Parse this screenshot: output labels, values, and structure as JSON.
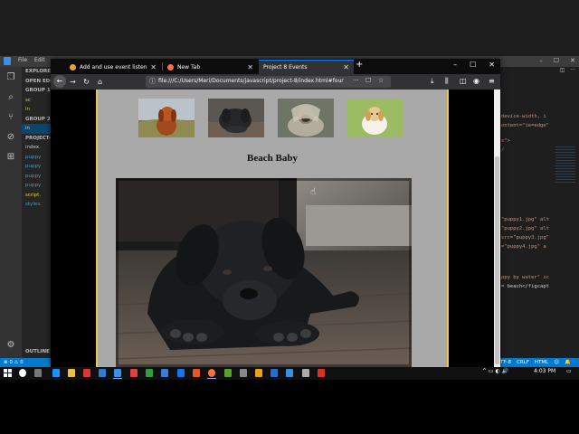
{
  "vscode": {
    "menu": [
      "File",
      "Edit"
    ],
    "explorer": {
      "title": "EXPLORER",
      "open_editors": "OPEN EDI",
      "group1": "GROUP 1",
      "group1_files": [
        "sc",
        "in"
      ],
      "group2": "GROUP 2",
      "group2_files": [
        "in"
      ],
      "project": "PROJECT-",
      "files": [
        "index.",
        "puppy",
        "puppy",
        "puppy",
        "puppy",
        "script.",
        "styles."
      ],
      "outline": "OUTLINE"
    },
    "code_lines": [
      {
        "text": "device-width, i",
        "color": "#ce9178"
      },
      {
        "text": "ontent=\"ie=edge\"",
        "color": "#ce9178"
      },
      {
        "text": "s\">",
        "color": "#ce9178"
      },
      {
        "text": "/",
        "color": "#808080"
      },
      {
        "text": "\"puppy1.jpg\" alt",
        "color": "#ce9178"
      },
      {
        "text": "\"puppy2.jpg\" alt",
        "color": "#ce9178"
      },
      {
        "text": "src=\"puppy3.jpg\"",
        "color": "#ce9178"
      },
      {
        "text": "=\"puppy4.jpg\" a",
        "color": "#ce9178"
      },
      {
        "text": "ppy by water\" ic",
        "color": "#ce9178"
      },
      {
        "text": "= beach</figcapt",
        "color": "#d4d4d4"
      }
    ],
    "status_left": "⊗ 0 ⚠ 0",
    "status_right": [
      "TF-8",
      "CRLF",
      "HTML",
      "☺",
      "🔔"
    ]
  },
  "browser": {
    "tabs": [
      {
        "title": "Add and use event listeners",
        "favicon_color": "#e8a23a",
        "active": false
      },
      {
        "title": "New Tab",
        "favicon_color": "#ff7139",
        "active": false
      },
      {
        "title": "Project 8 Events",
        "favicon_color": "",
        "active": true
      }
    ],
    "new_tab_symbol": "+",
    "window_controls": [
      "–",
      "☐",
      "✕"
    ],
    "url": "file:///C:/Users/Meri/Documents/javascript/project-8/index.html#four",
    "url_actions": [
      "···",
      "☐",
      "☆"
    ]
  },
  "page": {
    "caption": "Beach Baby",
    "thumbnails": [
      {
        "name": "puppy-thumbnail-1",
        "interactable": true
      },
      {
        "name": "puppy-thumbnail-2",
        "interactable": true
      },
      {
        "name": "puppy-thumbnail-3",
        "interactable": true
      },
      {
        "name": "puppy-thumbnail-4",
        "interactable": true
      }
    ]
  },
  "taskbar": {
    "clock": "4:03 PM",
    "tray_icons": "^ ▭ ◐ 🔊"
  },
  "colors": {
    "page_background": "#a9a9a9",
    "page_border": "#e8c84c",
    "vscode_status": "#007acc",
    "firefox_accent": "#0a84ff"
  }
}
